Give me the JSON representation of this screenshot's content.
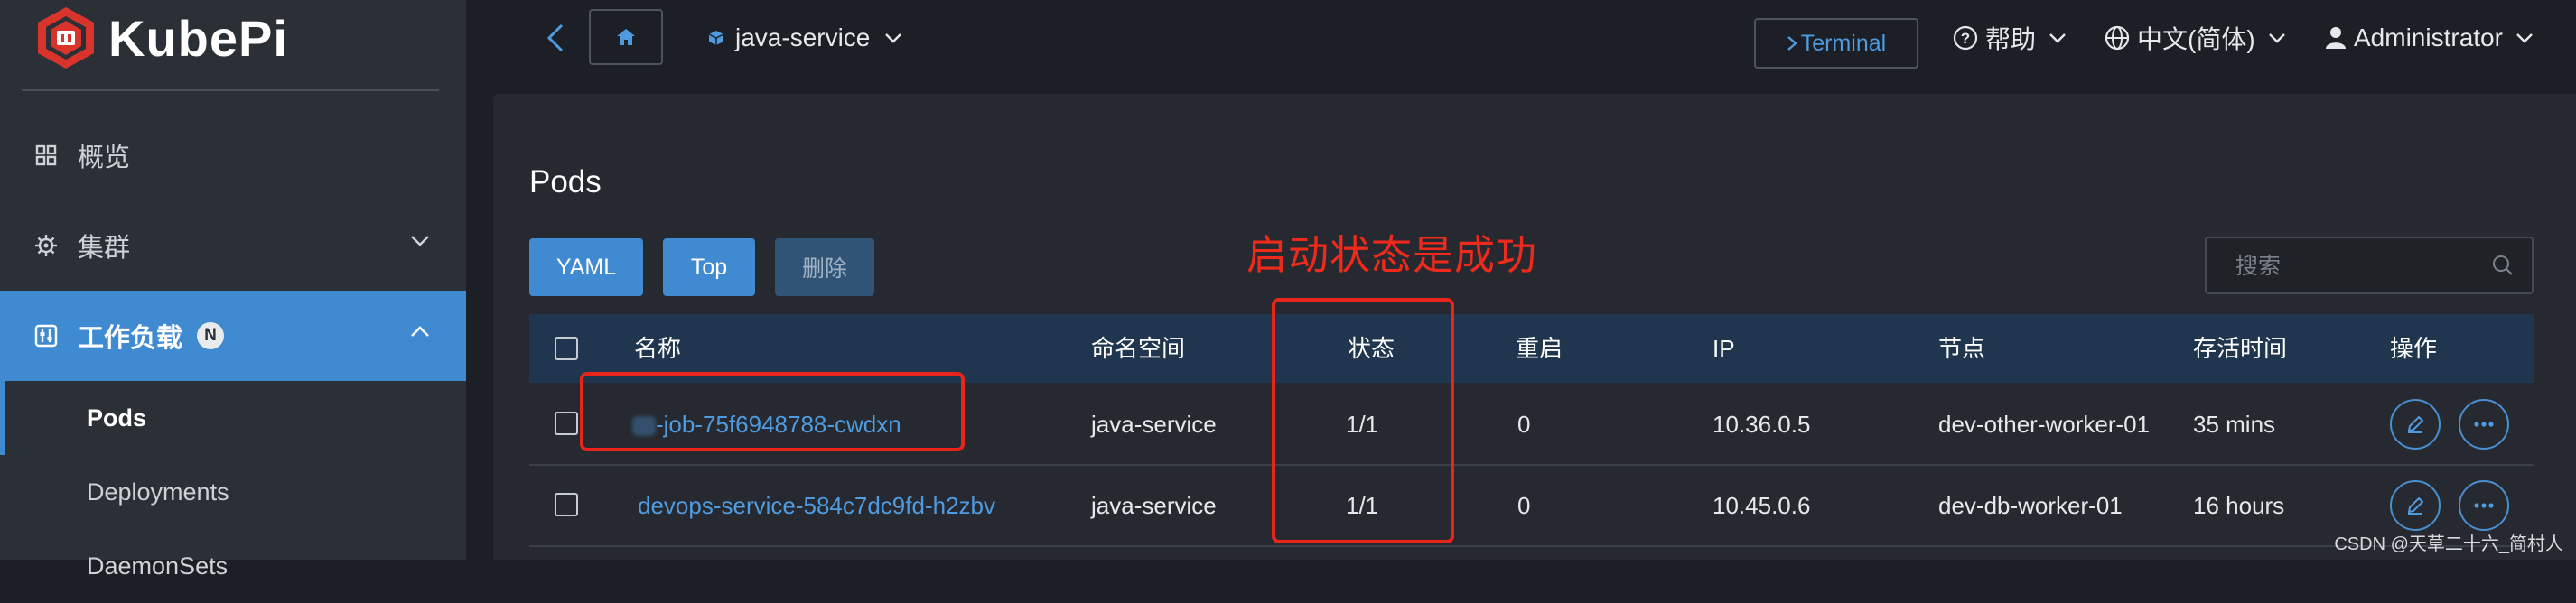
{
  "app": {
    "brand": "KubePi"
  },
  "sidebar": {
    "items": [
      {
        "label": "概览",
        "icon": "dashboard-icon"
      },
      {
        "label": "集群",
        "icon": "helm-wheel-icon"
      },
      {
        "label": "工作负载",
        "icon": "workload-icon",
        "badge": "N",
        "active": true
      }
    ],
    "subitems": [
      {
        "label": "Pods",
        "current": true
      },
      {
        "label": "Deployments"
      },
      {
        "label": "DaemonSets"
      }
    ]
  },
  "topbar": {
    "namespace": "java-service",
    "terminal_label": "Terminal",
    "help_label": "帮助",
    "language_label": "中文(简体)",
    "user_label": "Administrator"
  },
  "page": {
    "title": "Pods",
    "buttons": {
      "yaml": "YAML",
      "top": "Top",
      "delete": "删除"
    },
    "search_placeholder": "搜索",
    "annotation": "启动状态是成功"
  },
  "table": {
    "columns": [
      "名称",
      "命名空间",
      "状态",
      "重启",
      "IP",
      "节点",
      "存活时间",
      "操作"
    ],
    "rows": [
      {
        "name": "-job-75f6948788-cwdxn",
        "namespace": "java-service",
        "status": "1/1",
        "restarts": "0",
        "ip": "10.36.0.5",
        "node": "dev-other-worker-01",
        "age": "35 mins"
      },
      {
        "name": "devops-service-584c7dc9fd-h2zbv",
        "namespace": "java-service",
        "status": "1/1",
        "restarts": "0",
        "ip": "10.45.0.6",
        "node": "dev-db-worker-01",
        "age": "16 hours"
      }
    ]
  },
  "watermark": "CSDN @天草二十六_简村人",
  "colors": {
    "accent": "#3f8ad1",
    "annotation": "#e8251b",
    "header_bg": "#20364e"
  }
}
